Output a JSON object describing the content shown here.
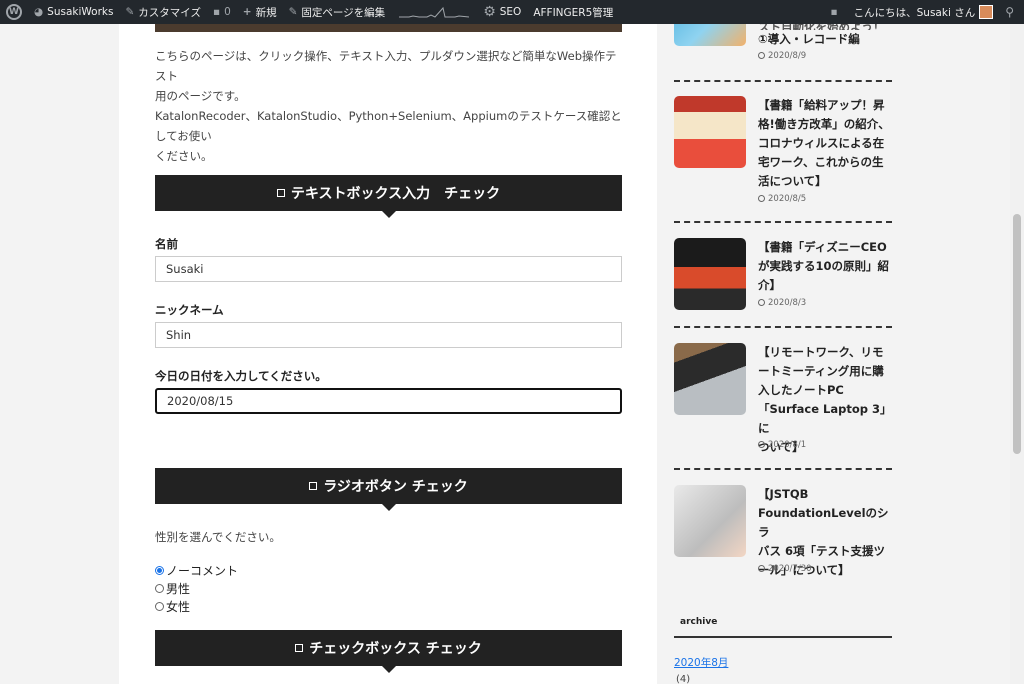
{
  "adminbar": {
    "site_name": "SusakiWorks",
    "customize": "カスタマイズ",
    "comments_count": "0",
    "new_label": "新規",
    "edit_page": "固定ページを編集",
    "seo": "SEO",
    "affinger": "AFFINGER5管理",
    "greeting": "こんにちは、Susaki さん"
  },
  "main": {
    "intro_lines": [
      "こちらのページは、クリック操作、テキスト入力、プルダウン選択など簡単なWeb操作テスト",
      "用のページです。",
      "KatalonRecoder、KatalonStudio、Python+Selenium、Appiumのテストケース確認としてお使い",
      "ください。"
    ],
    "section_text": "テキストボックス入力　チェック",
    "name_label": "名前",
    "name_value": "Susaki",
    "nickname_label": "ニックネーム",
    "nickname_value": "Shin",
    "date_label": "今日の日付を入力してください。",
    "date_value": "2020/08/15",
    "section_radio": "ラジオボタン チェック",
    "gender_prompt": "性別を選んでください。",
    "radio_options": [
      "ノーコメント",
      "男性",
      "女性"
    ],
    "radio_selected": "ノーコメント",
    "section_checkbox": "チェックボックス チェック"
  },
  "sidebar": {
    "posts": [
      {
        "title_lines": [
          "①導入・レコード編"
        ],
        "title_top_partial": "スト自動化を始めよう！",
        "date": "2020/8/9"
      },
      {
        "title_lines": [
          "【書籍「給料アップ！昇",
          "格!働き方改革」の紹介、",
          "コロナウィルスによる在",
          "宅ワーク、これからの生",
          "活について】"
        ],
        "date": "2020/8/5"
      },
      {
        "title_lines": [
          "【書籍「ディズニーCEO",
          "が実践する10の原則」紹",
          "介】"
        ],
        "date": "2020/8/3"
      },
      {
        "title_lines": [
          "【リモートワーク、リモ",
          "ートミーティング用に購",
          "入したノートPC",
          "「Surface Laptop 3」に",
          "ついて】"
        ],
        "date": "2020/8/1"
      },
      {
        "title_lines": [
          "【JSTQB",
          "FoundationLevelのシラ",
          "バス 6項「テスト支援ツ",
          "ール」について】"
        ],
        "date": "2020/7/30"
      }
    ],
    "archive_title": "archive",
    "archive_link": "2020年8月",
    "archive_count": "(4)"
  },
  "colors": {
    "section_bg": "#222222",
    "link": "#1a73e8",
    "adminbar_bg": "#23282d"
  }
}
